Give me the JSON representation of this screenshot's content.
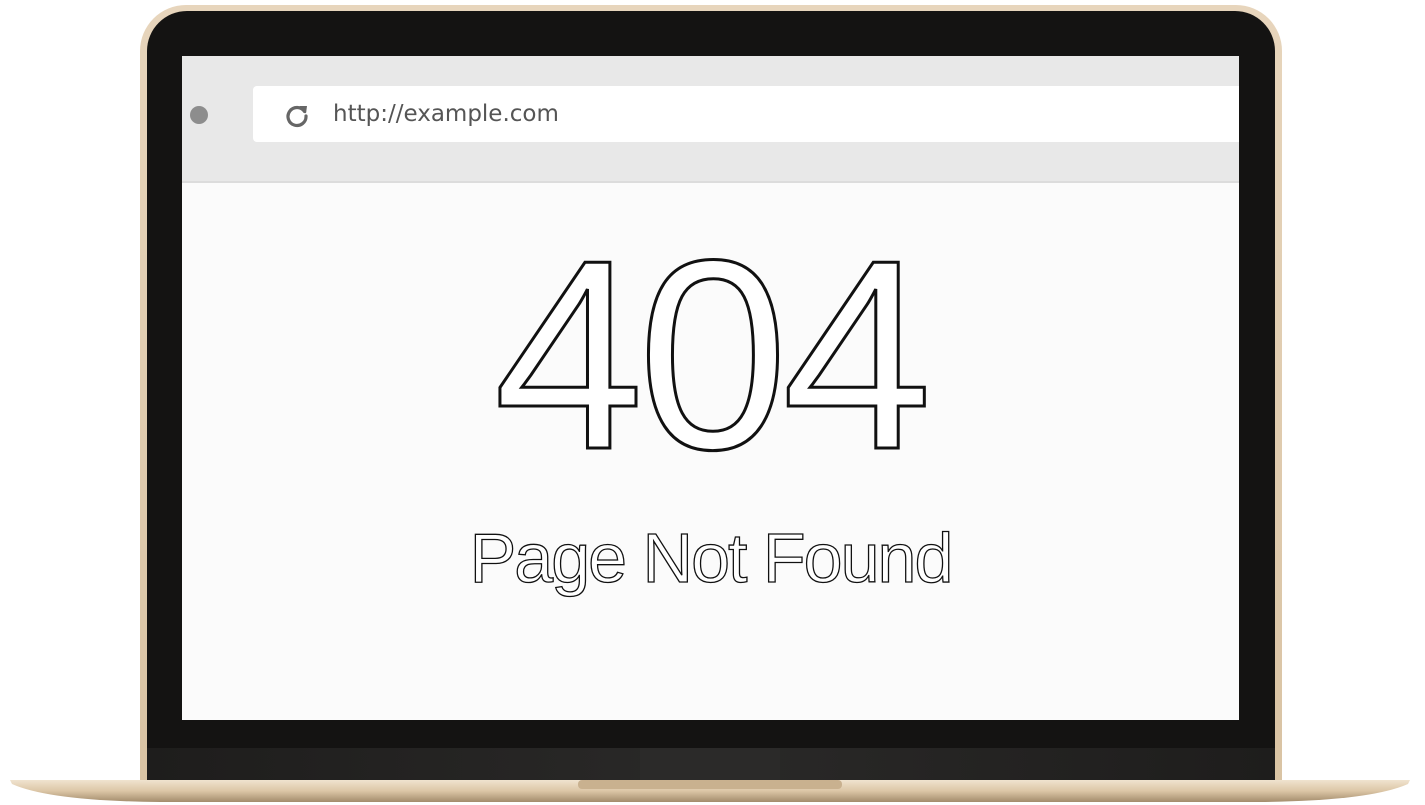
{
  "browser": {
    "url": "http://example.com",
    "reload_icon": "reload-icon",
    "window_dot_icon": "window-dot-icon"
  },
  "page": {
    "error_code": "404",
    "error_message": "Page Not Found"
  },
  "colors": {
    "bezel": "#141312",
    "gold_frame": "#e2cfb4",
    "toolbar": "#e8e8e8",
    "screen_bg": "#fbfbfb",
    "text": "#111111"
  }
}
